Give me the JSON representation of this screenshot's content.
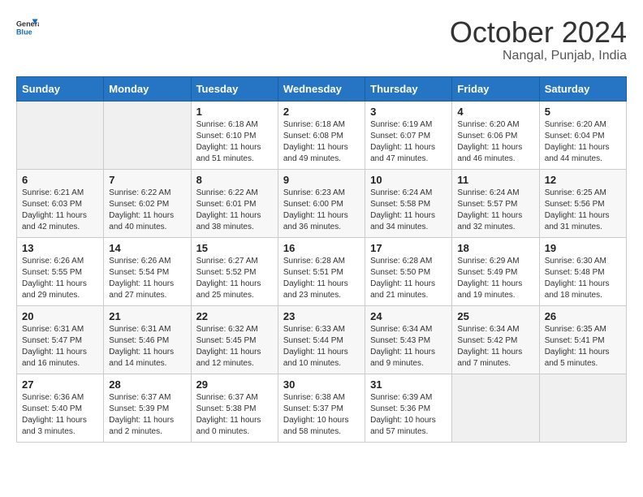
{
  "header": {
    "logo_general": "General",
    "logo_blue": "Blue",
    "month": "October 2024",
    "location": "Nangal, Punjab, India"
  },
  "weekdays": [
    "Sunday",
    "Monday",
    "Tuesday",
    "Wednesday",
    "Thursday",
    "Friday",
    "Saturday"
  ],
  "weeks": [
    [
      {
        "day": "",
        "empty": true
      },
      {
        "day": "",
        "empty": true
      },
      {
        "day": "1",
        "sunrise": "6:18 AM",
        "sunset": "6:10 PM",
        "daylight": "11 hours and 51 minutes."
      },
      {
        "day": "2",
        "sunrise": "6:18 AM",
        "sunset": "6:08 PM",
        "daylight": "11 hours and 49 minutes."
      },
      {
        "day": "3",
        "sunrise": "6:19 AM",
        "sunset": "6:07 PM",
        "daylight": "11 hours and 47 minutes."
      },
      {
        "day": "4",
        "sunrise": "6:20 AM",
        "sunset": "6:06 PM",
        "daylight": "11 hours and 46 minutes."
      },
      {
        "day": "5",
        "sunrise": "6:20 AM",
        "sunset": "6:04 PM",
        "daylight": "11 hours and 44 minutes."
      }
    ],
    [
      {
        "day": "6",
        "sunrise": "6:21 AM",
        "sunset": "6:03 PM",
        "daylight": "11 hours and 42 minutes."
      },
      {
        "day": "7",
        "sunrise": "6:22 AM",
        "sunset": "6:02 PM",
        "daylight": "11 hours and 40 minutes."
      },
      {
        "day": "8",
        "sunrise": "6:22 AM",
        "sunset": "6:01 PM",
        "daylight": "11 hours and 38 minutes."
      },
      {
        "day": "9",
        "sunrise": "6:23 AM",
        "sunset": "6:00 PM",
        "daylight": "11 hours and 36 minutes."
      },
      {
        "day": "10",
        "sunrise": "6:24 AM",
        "sunset": "5:58 PM",
        "daylight": "11 hours and 34 minutes."
      },
      {
        "day": "11",
        "sunrise": "6:24 AM",
        "sunset": "5:57 PM",
        "daylight": "11 hours and 32 minutes."
      },
      {
        "day": "12",
        "sunrise": "6:25 AM",
        "sunset": "5:56 PM",
        "daylight": "11 hours and 31 minutes."
      }
    ],
    [
      {
        "day": "13",
        "sunrise": "6:26 AM",
        "sunset": "5:55 PM",
        "daylight": "11 hours and 29 minutes."
      },
      {
        "day": "14",
        "sunrise": "6:26 AM",
        "sunset": "5:54 PM",
        "daylight": "11 hours and 27 minutes."
      },
      {
        "day": "15",
        "sunrise": "6:27 AM",
        "sunset": "5:52 PM",
        "daylight": "11 hours and 25 minutes."
      },
      {
        "day": "16",
        "sunrise": "6:28 AM",
        "sunset": "5:51 PM",
        "daylight": "11 hours and 23 minutes."
      },
      {
        "day": "17",
        "sunrise": "6:28 AM",
        "sunset": "5:50 PM",
        "daylight": "11 hours and 21 minutes."
      },
      {
        "day": "18",
        "sunrise": "6:29 AM",
        "sunset": "5:49 PM",
        "daylight": "11 hours and 19 minutes."
      },
      {
        "day": "19",
        "sunrise": "6:30 AM",
        "sunset": "5:48 PM",
        "daylight": "11 hours and 18 minutes."
      }
    ],
    [
      {
        "day": "20",
        "sunrise": "6:31 AM",
        "sunset": "5:47 PM",
        "daylight": "11 hours and 16 minutes."
      },
      {
        "day": "21",
        "sunrise": "6:31 AM",
        "sunset": "5:46 PM",
        "daylight": "11 hours and 14 minutes."
      },
      {
        "day": "22",
        "sunrise": "6:32 AM",
        "sunset": "5:45 PM",
        "daylight": "11 hours and 12 minutes."
      },
      {
        "day": "23",
        "sunrise": "6:33 AM",
        "sunset": "5:44 PM",
        "daylight": "11 hours and 10 minutes."
      },
      {
        "day": "24",
        "sunrise": "6:34 AM",
        "sunset": "5:43 PM",
        "daylight": "11 hours and 9 minutes."
      },
      {
        "day": "25",
        "sunrise": "6:34 AM",
        "sunset": "5:42 PM",
        "daylight": "11 hours and 7 minutes."
      },
      {
        "day": "26",
        "sunrise": "6:35 AM",
        "sunset": "5:41 PM",
        "daylight": "11 hours and 5 minutes."
      }
    ],
    [
      {
        "day": "27",
        "sunrise": "6:36 AM",
        "sunset": "5:40 PM",
        "daylight": "11 hours and 3 minutes."
      },
      {
        "day": "28",
        "sunrise": "6:37 AM",
        "sunset": "5:39 PM",
        "daylight": "11 hours and 2 minutes."
      },
      {
        "day": "29",
        "sunrise": "6:37 AM",
        "sunset": "5:38 PM",
        "daylight": "11 hours and 0 minutes."
      },
      {
        "day": "30",
        "sunrise": "6:38 AM",
        "sunset": "5:37 PM",
        "daylight": "10 hours and 58 minutes."
      },
      {
        "day": "31",
        "sunrise": "6:39 AM",
        "sunset": "5:36 PM",
        "daylight": "10 hours and 57 minutes."
      },
      {
        "day": "",
        "empty": true
      },
      {
        "day": "",
        "empty": true
      }
    ]
  ]
}
